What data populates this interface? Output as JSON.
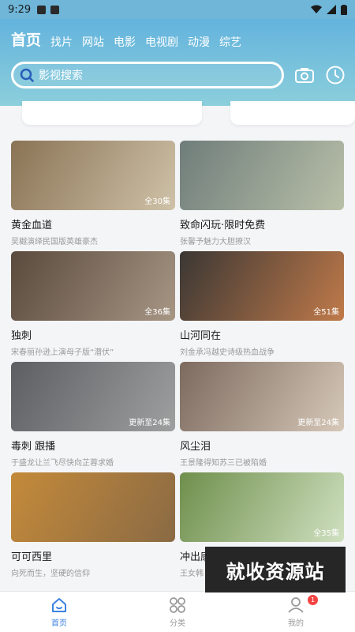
{
  "status": {
    "time": "9:29"
  },
  "nav": {
    "tabs": [
      "首页",
      "找片",
      "网站",
      "电影",
      "电视剧",
      "动漫",
      "综艺"
    ],
    "active": 0
  },
  "search": {
    "placeholder": "影视搜索"
  },
  "header_icons": {
    "camera": "camera-icon",
    "history": "clock-icon"
  },
  "items": [
    {
      "title": "黄金血道",
      "sub": "吴樾演绎民国版英雄豪杰",
      "badge": "全30集",
      "colors": [
        "#8a7355",
        "#cfc2a8"
      ]
    },
    {
      "title": "致命闪玩·限时免费",
      "sub": "张馨予魅力大胆撩汉",
      "badge": "",
      "colors": [
        "#6f7d7a",
        "#b9c0a9"
      ]
    },
    {
      "title": "独刺",
      "sub": "宋春丽孙逊上演母子版“潜伏”",
      "badge": "全36集",
      "colors": [
        "#5a4a3d",
        "#a79684"
      ]
    },
    {
      "title": "山河同在",
      "sub": "刘金承冯越史诗级热血战争",
      "badge": "全51集",
      "colors": [
        "#3b3734",
        "#c07a4a"
      ]
    },
    {
      "title": "毒刺 跟播",
      "sub": "于盛龙让兰飞尽快向芷蓉求婚",
      "badge": "更新至24集",
      "colors": [
        "#5c5e62",
        "#9ea0a0"
      ]
    },
    {
      "title": "风尘泪",
      "sub": "王景隆得知苏三已被陷婚",
      "badge": "更新至24集",
      "colors": [
        "#7c6a5e",
        "#d6c8b8"
      ]
    },
    {
      "title": "可可西里",
      "sub": "向死而生，坚硬的信仰",
      "badge": "",
      "colors": [
        "#c48a3a",
        "#8a6a44"
      ]
    },
    {
      "title": "冲出康",
      "sub": "王女韩",
      "badge": "全35集",
      "colors": [
        "#6f8f4c",
        "#cfe0c0"
      ]
    }
  ],
  "bottom_nav": [
    {
      "label": "首页",
      "icon": "home-icon",
      "active": true
    },
    {
      "label": "分类",
      "icon": "category-icon",
      "active": false
    },
    {
      "label": "我的",
      "icon": "user-icon",
      "active": false,
      "badge": "1"
    }
  ],
  "watermark": "就收资源站",
  "colors": {
    "accent": "#3b82e0",
    "header": "#63b3dd",
    "badge": "#f34343"
  }
}
